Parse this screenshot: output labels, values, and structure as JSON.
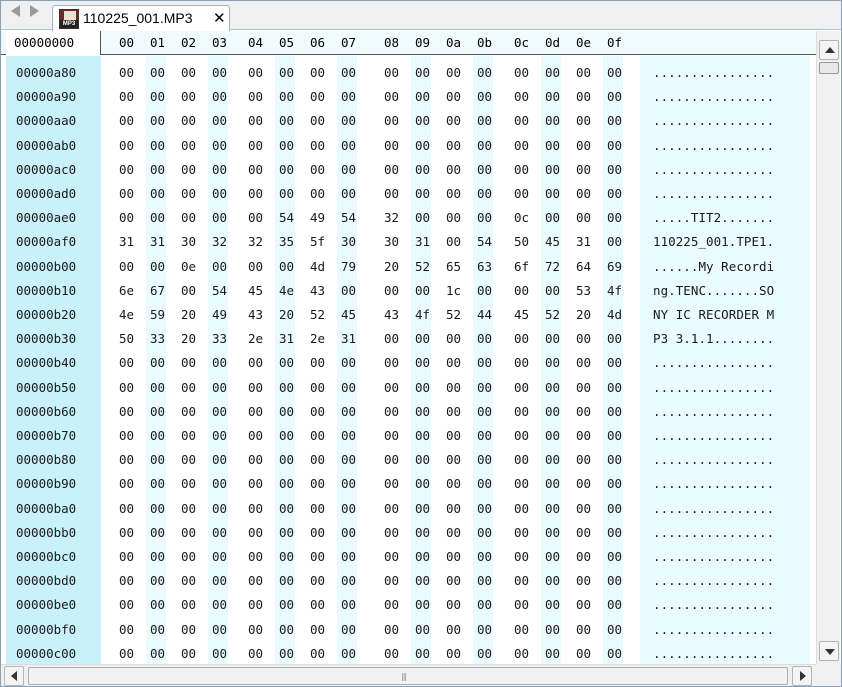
{
  "tab": {
    "title": "110225_001.MP3",
    "icon_label": "MP3",
    "close_glyph": "✕"
  },
  "header": {
    "address_label": "00000000",
    "columns": [
      "00",
      "01",
      "02",
      "03",
      "04",
      "05",
      "06",
      "07",
      "08",
      "09",
      "0a",
      "0b",
      "0c",
      "0d",
      "0e",
      "0f"
    ]
  },
  "rows": [
    {
      "addr": "00000a80",
      "bytes": [
        "00",
        "00",
        "00",
        "00",
        "00",
        "00",
        "00",
        "00",
        "00",
        "00",
        "00",
        "00",
        "00",
        "00",
        "00",
        "00"
      ],
      "ascii": "................"
    },
    {
      "addr": "00000a90",
      "bytes": [
        "00",
        "00",
        "00",
        "00",
        "00",
        "00",
        "00",
        "00",
        "00",
        "00",
        "00",
        "00",
        "00",
        "00",
        "00",
        "00"
      ],
      "ascii": "................"
    },
    {
      "addr": "00000aa0",
      "bytes": [
        "00",
        "00",
        "00",
        "00",
        "00",
        "00",
        "00",
        "00",
        "00",
        "00",
        "00",
        "00",
        "00",
        "00",
        "00",
        "00"
      ],
      "ascii": "................"
    },
    {
      "addr": "00000ab0",
      "bytes": [
        "00",
        "00",
        "00",
        "00",
        "00",
        "00",
        "00",
        "00",
        "00",
        "00",
        "00",
        "00",
        "00",
        "00",
        "00",
        "00"
      ],
      "ascii": "................"
    },
    {
      "addr": "00000ac0",
      "bytes": [
        "00",
        "00",
        "00",
        "00",
        "00",
        "00",
        "00",
        "00",
        "00",
        "00",
        "00",
        "00",
        "00",
        "00",
        "00",
        "00"
      ],
      "ascii": "................"
    },
    {
      "addr": "00000ad0",
      "bytes": [
        "00",
        "00",
        "00",
        "00",
        "00",
        "00",
        "00",
        "00",
        "00",
        "00",
        "00",
        "00",
        "00",
        "00",
        "00",
        "00"
      ],
      "ascii": "................"
    },
    {
      "addr": "00000ae0",
      "bytes": [
        "00",
        "00",
        "00",
        "00",
        "00",
        "54",
        "49",
        "54",
        "32",
        "00",
        "00",
        "00",
        "0c",
        "00",
        "00",
        "00"
      ],
      "ascii": ".....TIT2......."
    },
    {
      "addr": "00000af0",
      "bytes": [
        "31",
        "31",
        "30",
        "32",
        "32",
        "35",
        "5f",
        "30",
        "30",
        "31",
        "00",
        "54",
        "50",
        "45",
        "31",
        "00"
      ],
      "ascii": "110225_001.TPE1."
    },
    {
      "addr": "00000b00",
      "bytes": [
        "00",
        "00",
        "0e",
        "00",
        "00",
        "00",
        "4d",
        "79",
        "20",
        "52",
        "65",
        "63",
        "6f",
        "72",
        "64",
        "69"
      ],
      "ascii": "......My Recordi"
    },
    {
      "addr": "00000b10",
      "bytes": [
        "6e",
        "67",
        "00",
        "54",
        "45",
        "4e",
        "43",
        "00",
        "00",
        "00",
        "1c",
        "00",
        "00",
        "00",
        "53",
        "4f"
      ],
      "ascii": "ng.TENC.......SO"
    },
    {
      "addr": "00000b20",
      "bytes": [
        "4e",
        "59",
        "20",
        "49",
        "43",
        "20",
        "52",
        "45",
        "43",
        "4f",
        "52",
        "44",
        "45",
        "52",
        "20",
        "4d"
      ],
      "ascii": "NY IC RECORDER M"
    },
    {
      "addr": "00000b30",
      "bytes": [
        "50",
        "33",
        "20",
        "33",
        "2e",
        "31",
        "2e",
        "31",
        "00",
        "00",
        "00",
        "00",
        "00",
        "00",
        "00",
        "00"
      ],
      "ascii": "P3 3.1.1........"
    },
    {
      "addr": "00000b40",
      "bytes": [
        "00",
        "00",
        "00",
        "00",
        "00",
        "00",
        "00",
        "00",
        "00",
        "00",
        "00",
        "00",
        "00",
        "00",
        "00",
        "00"
      ],
      "ascii": "................"
    },
    {
      "addr": "00000b50",
      "bytes": [
        "00",
        "00",
        "00",
        "00",
        "00",
        "00",
        "00",
        "00",
        "00",
        "00",
        "00",
        "00",
        "00",
        "00",
        "00",
        "00"
      ],
      "ascii": "................"
    },
    {
      "addr": "00000b60",
      "bytes": [
        "00",
        "00",
        "00",
        "00",
        "00",
        "00",
        "00",
        "00",
        "00",
        "00",
        "00",
        "00",
        "00",
        "00",
        "00",
        "00"
      ],
      "ascii": "................"
    },
    {
      "addr": "00000b70",
      "bytes": [
        "00",
        "00",
        "00",
        "00",
        "00",
        "00",
        "00",
        "00",
        "00",
        "00",
        "00",
        "00",
        "00",
        "00",
        "00",
        "00"
      ],
      "ascii": "................"
    },
    {
      "addr": "00000b80",
      "bytes": [
        "00",
        "00",
        "00",
        "00",
        "00",
        "00",
        "00",
        "00",
        "00",
        "00",
        "00",
        "00",
        "00",
        "00",
        "00",
        "00"
      ],
      "ascii": "................"
    },
    {
      "addr": "00000b90",
      "bytes": [
        "00",
        "00",
        "00",
        "00",
        "00",
        "00",
        "00",
        "00",
        "00",
        "00",
        "00",
        "00",
        "00",
        "00",
        "00",
        "00"
      ],
      "ascii": "................"
    },
    {
      "addr": "00000ba0",
      "bytes": [
        "00",
        "00",
        "00",
        "00",
        "00",
        "00",
        "00",
        "00",
        "00",
        "00",
        "00",
        "00",
        "00",
        "00",
        "00",
        "00"
      ],
      "ascii": "................"
    },
    {
      "addr": "00000bb0",
      "bytes": [
        "00",
        "00",
        "00",
        "00",
        "00",
        "00",
        "00",
        "00",
        "00",
        "00",
        "00",
        "00",
        "00",
        "00",
        "00",
        "00"
      ],
      "ascii": "................"
    },
    {
      "addr": "00000bc0",
      "bytes": [
        "00",
        "00",
        "00",
        "00",
        "00",
        "00",
        "00",
        "00",
        "00",
        "00",
        "00",
        "00",
        "00",
        "00",
        "00",
        "00"
      ],
      "ascii": "................"
    },
    {
      "addr": "00000bd0",
      "bytes": [
        "00",
        "00",
        "00",
        "00",
        "00",
        "00",
        "00",
        "00",
        "00",
        "00",
        "00",
        "00",
        "00",
        "00",
        "00",
        "00"
      ],
      "ascii": "................"
    },
    {
      "addr": "00000be0",
      "bytes": [
        "00",
        "00",
        "00",
        "00",
        "00",
        "00",
        "00",
        "00",
        "00",
        "00",
        "00",
        "00",
        "00",
        "00",
        "00",
        "00"
      ],
      "ascii": "................"
    },
    {
      "addr": "00000bf0",
      "bytes": [
        "00",
        "00",
        "00",
        "00",
        "00",
        "00",
        "00",
        "00",
        "00",
        "00",
        "00",
        "00",
        "00",
        "00",
        "00",
        "00"
      ],
      "ascii": "................"
    },
    {
      "addr": "00000c00",
      "bytes": [
        "00",
        "00",
        "00",
        "00",
        "00",
        "00",
        "00",
        "00",
        "00",
        "00",
        "00",
        "00",
        "00",
        "00",
        "00",
        "00"
      ],
      "ascii": "................"
    }
  ],
  "icons": {
    "nav_left": "arrow-left-icon",
    "nav_right": "arrow-right-icon",
    "file": "mp3-file-icon",
    "close": "close-icon",
    "grip": "grip-icon"
  },
  "scrollbars": {
    "grip_glyph": "|||"
  },
  "colors": {
    "gutter": "#c9f1fb",
    "stripe": "#e9fbff",
    "header_bg": "#f0faff"
  }
}
